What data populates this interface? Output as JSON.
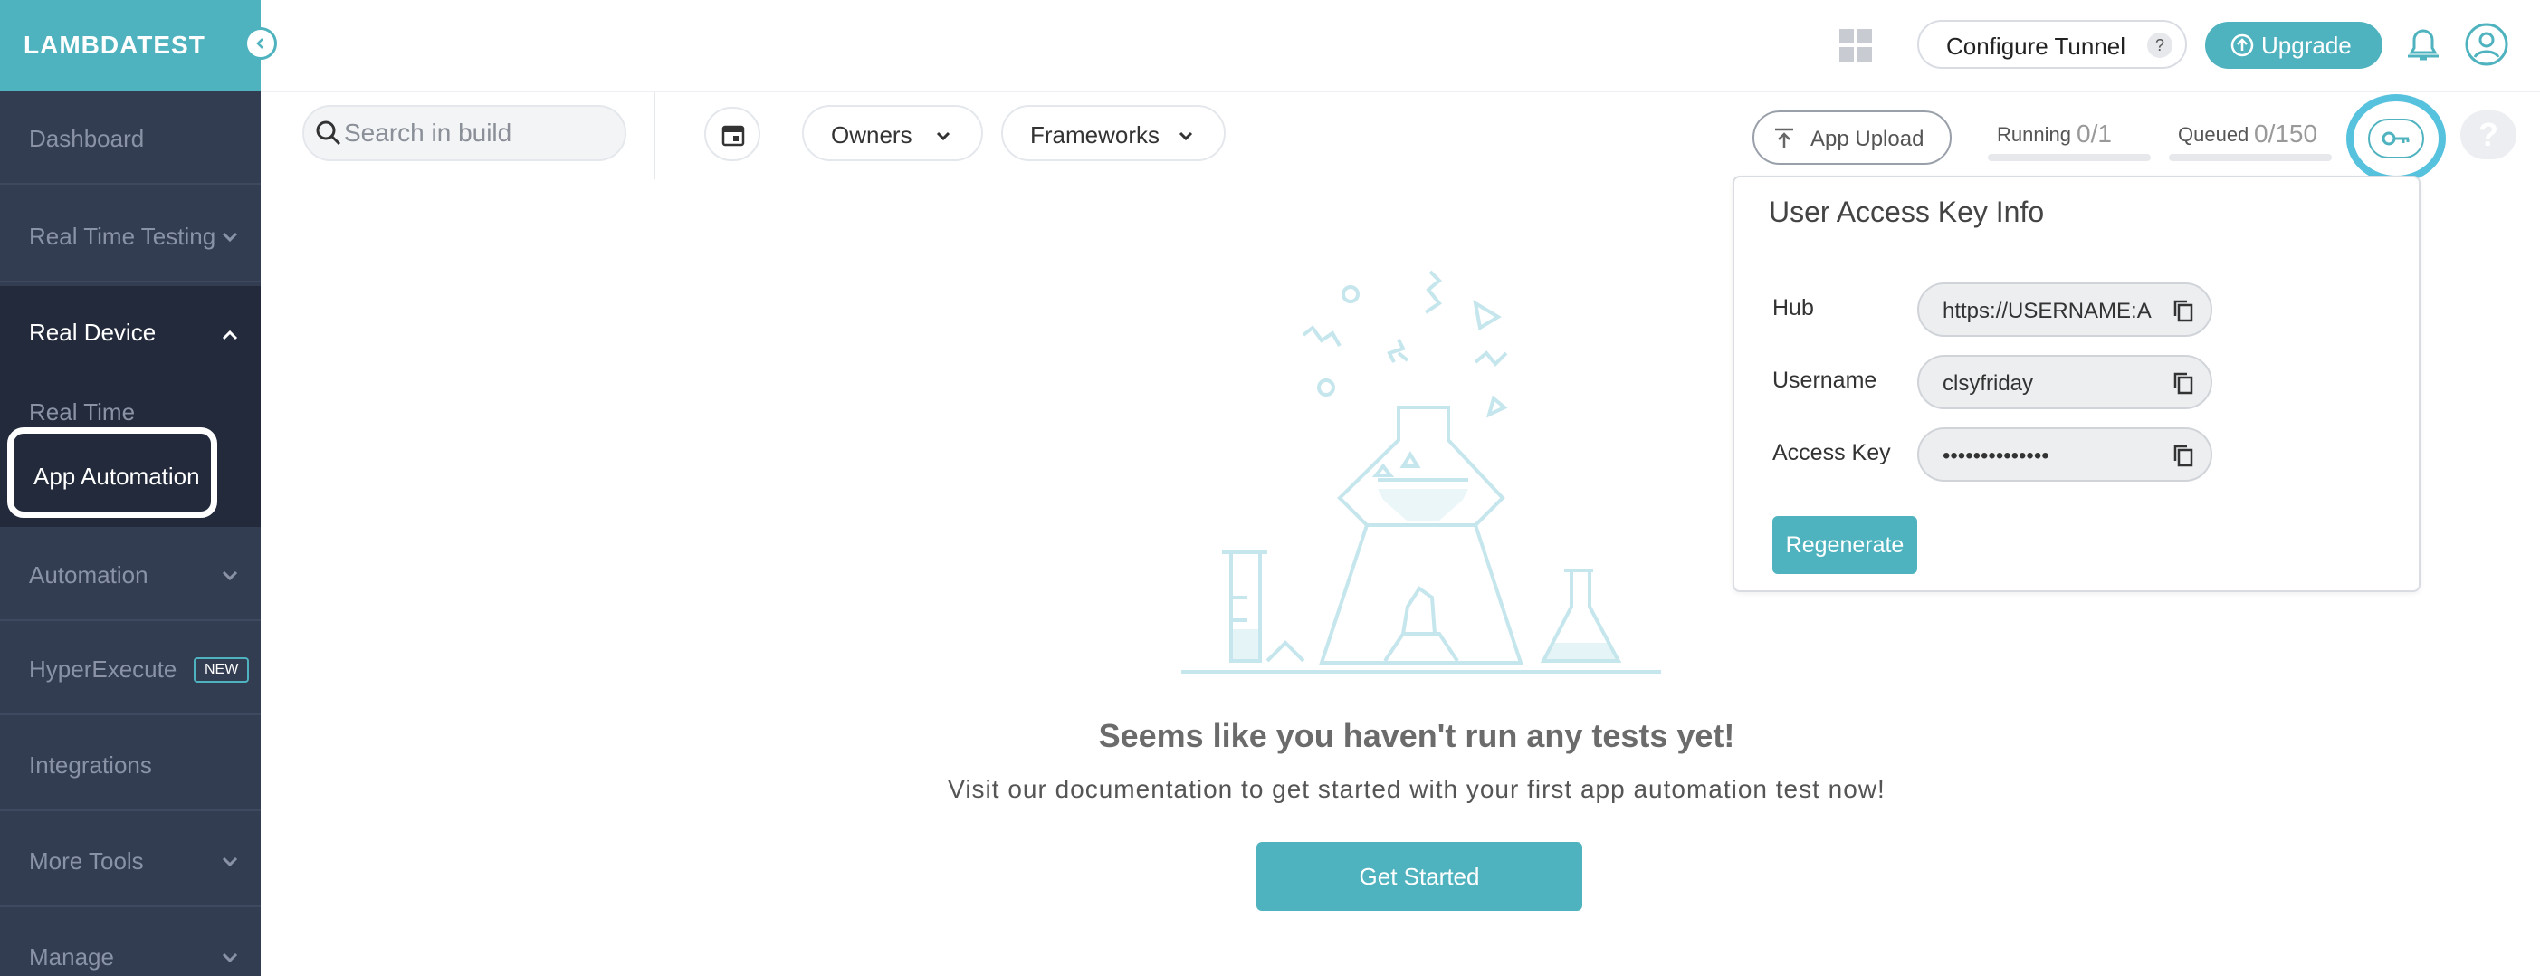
{
  "brand": {
    "logo": "LAMBDATEST",
    "accent": "#4fb3bf",
    "sidebar_bg": "#333d52"
  },
  "sidebar": {
    "items": [
      {
        "label": "Dashboard"
      },
      {
        "label": "Real Time Testing"
      },
      {
        "label": "Real Device"
      },
      {
        "label": "Real Time"
      },
      {
        "label": "App Automation"
      },
      {
        "label": "Automation"
      },
      {
        "label": "HyperExecute",
        "badge": "NEW"
      },
      {
        "label": "Integrations"
      },
      {
        "label": "More Tools"
      },
      {
        "label": "Manage"
      }
    ]
  },
  "header": {
    "configure_tunnel": "Configure Tunnel",
    "tunnel_help": "?",
    "upgrade": "Upgrade"
  },
  "filters": {
    "search_placeholder": "Search in build",
    "owners": "Owners",
    "frameworks": "Frameworks",
    "app_upload": "App Upload",
    "running_label": "Running",
    "running_value": "0/1",
    "queued_label": "Queued",
    "queued_value": "0/150",
    "help": "?"
  },
  "access_key_popup": {
    "title": "User Access Key Info",
    "hub_label": "Hub",
    "hub_value": "https://USERNAME:A",
    "username_label": "Username",
    "username_value": "clsyfriday",
    "access_key_label": "Access Key",
    "access_key_value": "••••••••••••••",
    "regenerate": "Regenerate"
  },
  "empty_state": {
    "title": "Seems like you haven't run any tests yet!",
    "subtitle": "Visit our documentation to get started with your first app automation test now!",
    "cta": "Get Started"
  }
}
